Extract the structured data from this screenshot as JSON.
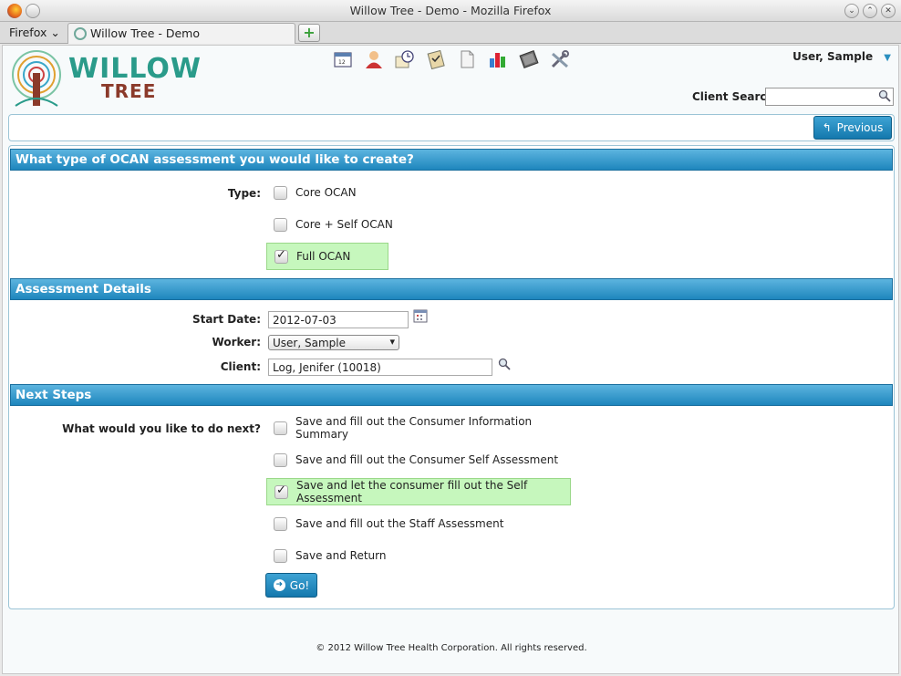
{
  "window": {
    "title": "Willow Tree - Demo - Mozilla Firefox",
    "minimize": "⌄",
    "maximize": "⌃",
    "close": "✕"
  },
  "tabs": {
    "menu_label": "Firefox",
    "active_tab": "Willow Tree - Demo",
    "new_tab": "+"
  },
  "header": {
    "logo_line1": "WILLOW",
    "logo_line2": "TREE",
    "toolbar_icons": [
      "calendar-icon",
      "user-icon",
      "schedule-icon",
      "checklist-icon",
      "document-icon",
      "chart-icon",
      "notebook-icon",
      "tools-icon"
    ],
    "user_name": "User, Sample",
    "client_search_label": "Client Search",
    "client_search_value": ""
  },
  "nav": {
    "previous_label": "Previous"
  },
  "sections": {
    "type_header": "What type of OCAN assessment you would like to create?",
    "details_header": "Assessment Details",
    "next_header": "Next Steps"
  },
  "type": {
    "label": "Type:",
    "options": [
      {
        "label": "Core OCAN",
        "checked": false
      },
      {
        "label": "Core + Self OCAN",
        "checked": false
      },
      {
        "label": "Full OCAN",
        "checked": true
      }
    ]
  },
  "details": {
    "start_date_label": "Start Date:",
    "start_date_value": "2012-07-03",
    "worker_label": "Worker:",
    "worker_value": "User, Sample",
    "client_label": "Client:",
    "client_value": "Log, Jenifer (10018)"
  },
  "next": {
    "label": "What would you like to do next?",
    "options": [
      {
        "label": "Save and fill out the Consumer Information Summary",
        "checked": false
      },
      {
        "label": "Save and fill out the Consumer Self Assessment",
        "checked": false
      },
      {
        "label": "Save and let the consumer fill out the Self Assessment",
        "checked": true
      },
      {
        "label": "Save and fill out the Staff Assessment",
        "checked": false
      },
      {
        "label": "Save and Return",
        "checked": false
      }
    ],
    "go_label": "Go!"
  },
  "footer": {
    "copyright": "© 2012 Willow Tree Health Corporation. All rights reserved."
  },
  "colors": {
    "header_blue": "#1e86bd",
    "selected_green": "#c6f7bd",
    "logo_green": "#2a9b8a",
    "logo_brown": "#8b3a2a"
  }
}
